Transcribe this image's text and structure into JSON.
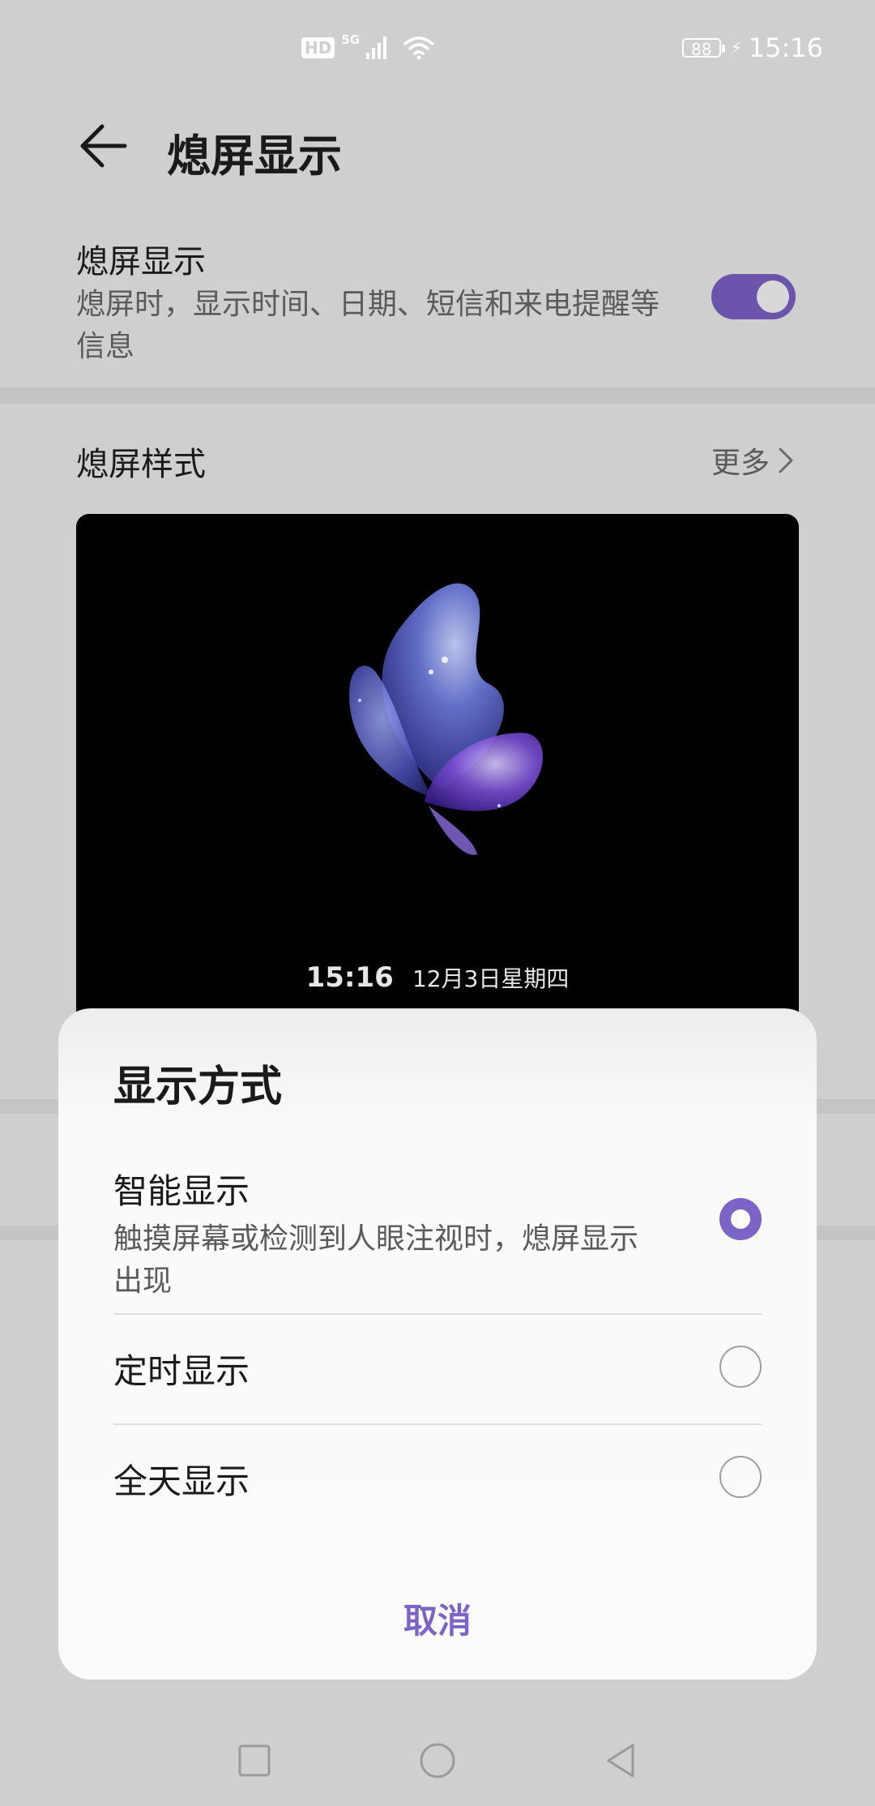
{
  "status_bar": {
    "hd": "HD",
    "network": "5G",
    "battery": "88",
    "time": "15:16"
  },
  "header": {
    "title": "熄屏显示"
  },
  "aod_setting": {
    "title": "熄屏显示",
    "subtitle": "熄屏时，显示时间、日期、短信和来电提醒等信息",
    "enabled": true,
    "accent_color": "#6b54ab"
  },
  "style_section": {
    "title": "熄屏样式",
    "more_label": "更多"
  },
  "preview": {
    "time": "15:16",
    "date": "12月3日星期四"
  },
  "dialog": {
    "title": "显示方式",
    "options": [
      {
        "label": "智能显示",
        "description": "触摸屏幕或检测到人眼注视时，熄屏显示出现",
        "selected": true
      },
      {
        "label": "定时显示",
        "selected": false
      },
      {
        "label": "全天显示",
        "selected": false
      }
    ],
    "cancel_label": "取消",
    "accent_color": "#7c63c8"
  },
  "nav_bar": {
    "icons": [
      "square-icon",
      "circle-icon",
      "triangle-back-icon"
    ]
  }
}
